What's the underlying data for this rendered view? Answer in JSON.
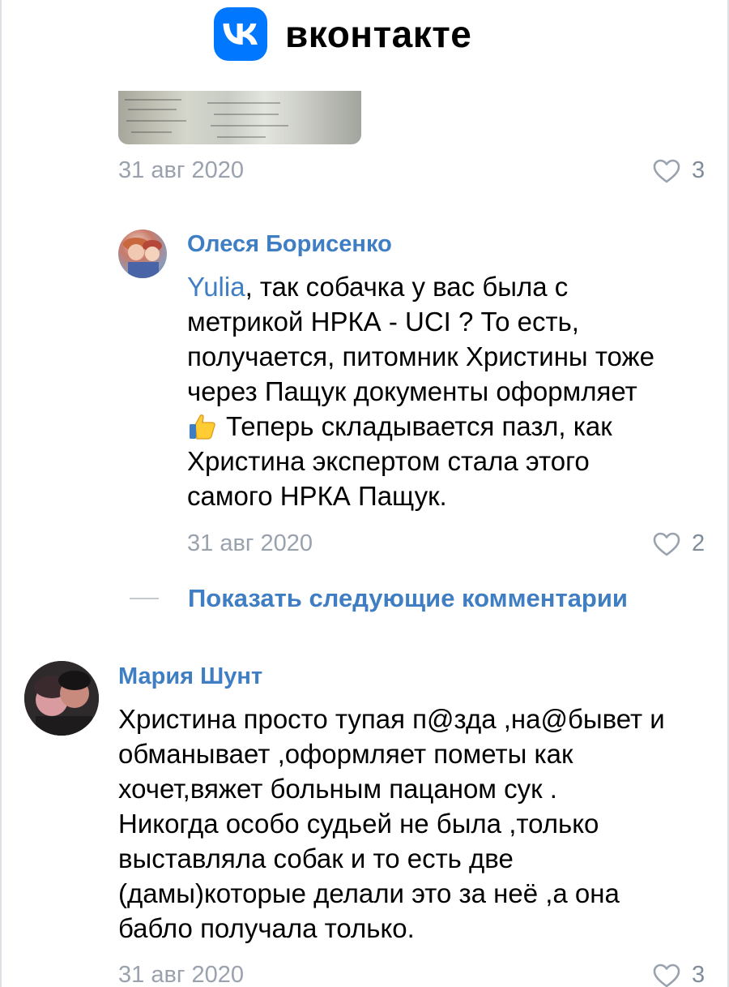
{
  "app": {
    "brand_name": "вконтакте",
    "logo_icon": "vk-logo-icon",
    "accent_color": "#0077ff",
    "link_color": "#3f7ec2"
  },
  "comments": [
    {
      "date": "31 авг 2020",
      "likes": "3"
    },
    {
      "author": "Олеся Борисенко",
      "mention": "Yulia",
      "text_line1_rest": ", так собачка у вас была с",
      "text_line2": "метрикой НРКА - UCI ? То есть,",
      "text_line3": "получается, питомник Христины тоже",
      "text_line4": "через Пащук документы оформляет",
      "text_line5_rest": "Теперь складывается пазл, как",
      "text_line6": "Христина экспертом стала этого",
      "text_line7": "самого НРКА Пащук.",
      "date": "31 авг 2020",
      "likes": "2"
    },
    {
      "author": "Мария Шунт",
      "text_lines": [
        "Христина просто тупая п@зда ,на@бывет и",
        "обманывает ,оформляет пометы как",
        "хочет,вяжет больным пацаном сук .",
        "Никогда особо судьей не была ,только",
        "выставляла собак и то есть две",
        "(дамы)которые делали это за неё ,а она",
        "бабло получала только."
      ],
      "date": "31 авг 2020",
      "likes": "3"
    }
  ],
  "show_more_label": "Показать следующие комментарии"
}
